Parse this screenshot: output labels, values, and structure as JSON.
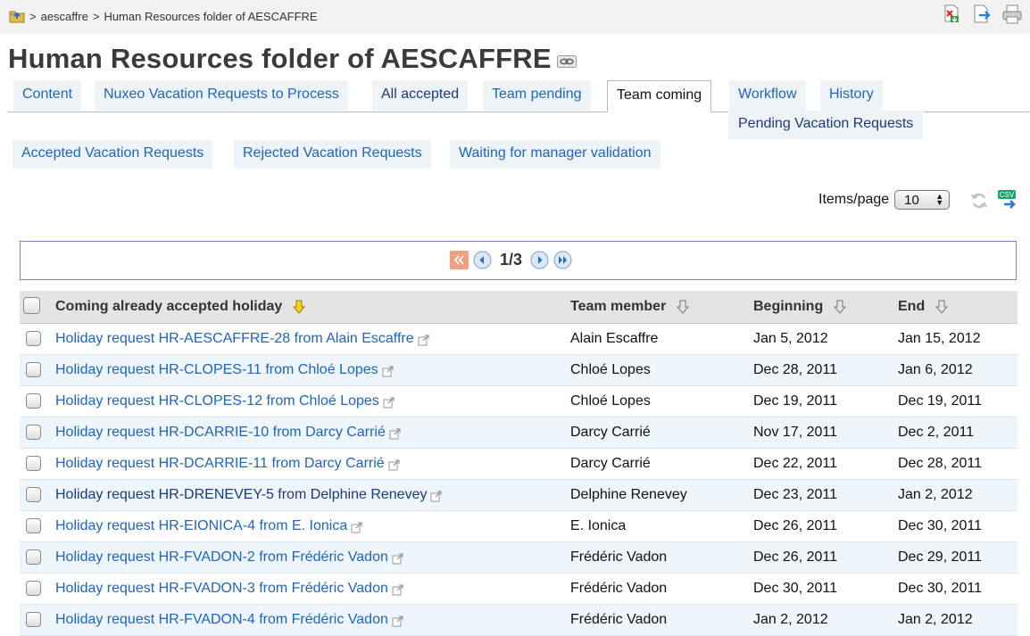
{
  "breadcrumb": {
    "separator1": ">",
    "workspace": "aescaffre",
    "separator2": ">",
    "folder": "Human Resources folder of AESCAFFRE"
  },
  "toolbar": {
    "icons": [
      "pdf-export-icon",
      "export-icon",
      "print-icon"
    ]
  },
  "page": {
    "title": "Human Resources folder of AESCAFFRE"
  },
  "tabs": [
    {
      "label": "Content"
    },
    {
      "label": "Nuxeo Vacation Requests to Process"
    },
    {
      "label": "All accepted"
    },
    {
      "label": "Team pending"
    },
    {
      "label": "Team coming"
    },
    {
      "label": "Workflow"
    },
    {
      "label": "History"
    }
  ],
  "subtab": {
    "label": "Pending Vacation Requests"
  },
  "subtabs": [
    {
      "label": "Accepted Vacation Requests"
    },
    {
      "label": "Rejected Vacation Requests"
    },
    {
      "label": "Waiting for manager validation"
    }
  ],
  "items_per_page": {
    "label": "Items/page",
    "value": "10"
  },
  "pager": {
    "text": "1/3"
  },
  "table": {
    "columns": [
      "Coming already accepted holiday",
      "Team member",
      "Beginning",
      "End"
    ],
    "rows": [
      {
        "title": "Holiday request HR-AESCAFFRE-28 from Alain Escaffre",
        "member": "Alain Escaffre",
        "begin": "Jan 5, 2012",
        "end": "Jan 15, 2012"
      },
      {
        "title": "Holiday request HR-CLOPES-11 from Chloé Lopes",
        "member": "Chloé Lopes",
        "begin": "Dec 28, 2011",
        "end": "Jan 6, 2012"
      },
      {
        "title": "Holiday request HR-CLOPES-12 from Chloé Lopes",
        "member": "Chloé Lopes",
        "begin": "Dec 19, 2011",
        "end": "Dec 19, 2011"
      },
      {
        "title": "Holiday request HR-DCARRIE-10 from Darcy Carrié",
        "member": "Darcy Carrié",
        "begin": "Nov 17, 2011",
        "end": "Dec 2, 2011"
      },
      {
        "title": "Holiday request HR-DCARRIE-11 from Darcy Carrié",
        "member": "Darcy Carrié",
        "begin": "Dec 22, 2011",
        "end": "Dec 28, 2011"
      },
      {
        "title": "Holiday request HR-DRENEVEY-5 from Delphine Renevey",
        "member": "Delphine Renevey",
        "begin": "Dec 23, 2011",
        "end": "Jan 2, 2012"
      },
      {
        "title": "Holiday request HR-EIONICA-4 from E. Ionica",
        "member": "E. Ionica",
        "begin": "Dec 26, 2011",
        "end": "Dec 30, 2011"
      },
      {
        "title": "Holiday request HR-FVADON-2 from Frédéric Vadon",
        "member": "Frédéric Vadon",
        "begin": "Dec 26, 2011",
        "end": "Dec 29, 2011"
      },
      {
        "title": "Holiday request HR-FVADON-3 from Frédéric Vadon",
        "member": "Frédéric Vadon",
        "begin": "Dec 30, 2011",
        "end": "Dec 30, 2011"
      },
      {
        "title": "Holiday request HR-FVADON-4 from Frédéric Vadon",
        "member": "Frédéric Vadon",
        "begin": "Jan 2, 2012",
        "end": "Jan 2, 2012"
      }
    ]
  },
  "colors": {
    "link": "#1d64c4",
    "tab_bg": "#eef3f8",
    "row_alt": "#eef5fb",
    "header_bg": "#e4e4e4",
    "pager_border": "#6d8cc8"
  }
}
